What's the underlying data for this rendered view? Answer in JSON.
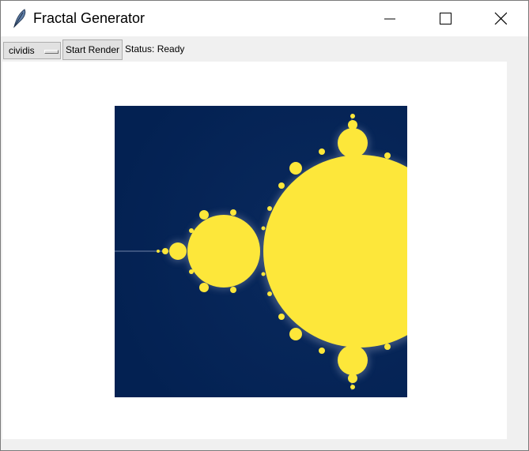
{
  "window": {
    "title": "Fractal Generator",
    "app_icon": "feather-icon",
    "controls": [
      "minimize-icon",
      "maximize-icon",
      "close-icon"
    ]
  },
  "toolbar": {
    "colormap": {
      "selected": "cividis"
    },
    "render_button": "Start Render",
    "status": "Status: Ready"
  },
  "fractal": {
    "type": "mandelbrot",
    "colors": {
      "background": "#042253",
      "set": "#fde73a",
      "halo": "#5b6f95"
    }
  }
}
